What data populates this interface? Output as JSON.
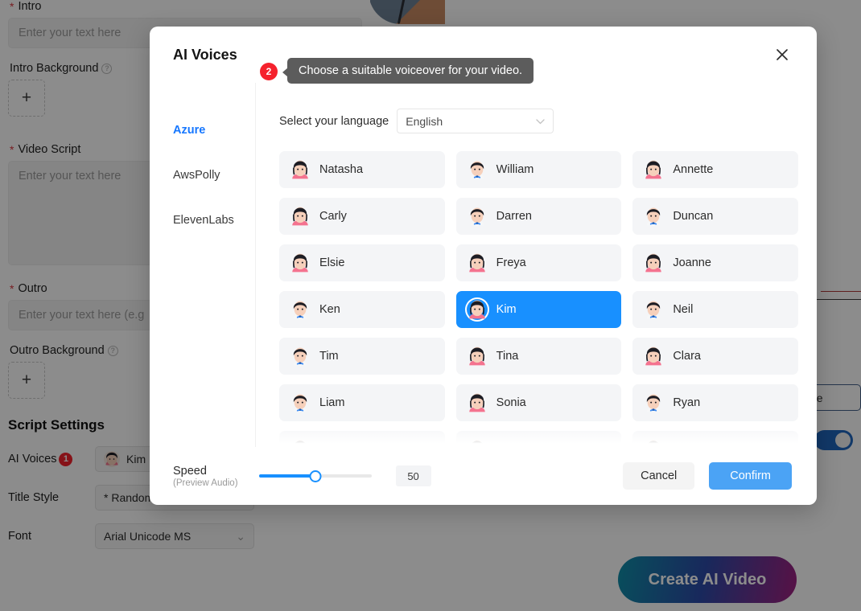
{
  "background": {
    "fields": [
      {
        "label": "Intro",
        "required": true,
        "placeholder": "Enter your text here",
        "type": "input"
      },
      {
        "label": "Intro Background",
        "required": false,
        "help": true,
        "type": "upload",
        "upload_glyph": "+"
      },
      {
        "label": "Video Script",
        "required": true,
        "placeholder": "Enter your text here",
        "type": "textarea"
      },
      {
        "label": "Outro",
        "required": true,
        "placeholder": "Enter your text here (e.g",
        "type": "input"
      },
      {
        "label": "Outro Background",
        "required": false,
        "help": true,
        "type": "upload",
        "upload_glyph": "+"
      }
    ],
    "section_title": "Script Settings",
    "settings": [
      {
        "label": "AI Voices",
        "badge": "1",
        "value": "Kim",
        "chev": "›",
        "has_avatar": true
      },
      {
        "label": "Title Style",
        "badge": "",
        "value": "* Random",
        "chev": "›",
        "has_avatar": false
      },
      {
        "label": "Font",
        "badge": "",
        "value": "Arial Unicode MS",
        "chev": "⌄",
        "has_avatar": false
      }
    ],
    "right_partial_button": "ne",
    "create_button": "Create AI Video",
    "create_gradient_from": "#0f8fa8",
    "create_gradient_to": "#a0207f"
  },
  "modal": {
    "title": "AI Voices",
    "close_glyph": "✕",
    "providers": [
      {
        "label": "Azure",
        "active": true
      },
      {
        "label": "AwsPolly",
        "active": false
      },
      {
        "label": "ElevenLabs",
        "active": false
      }
    ],
    "language": {
      "label": "Select your language",
      "selected": "English",
      "chevron": "⌄"
    },
    "tooltip": {
      "badge": "2",
      "text": "Choose a suitable voiceover for your video.",
      "bg": "#5c5c5c"
    },
    "selected_voice": "Kim",
    "accent_color": "#1890ff",
    "voices": [
      {
        "name": "Natasha",
        "gender": "female"
      },
      {
        "name": "William",
        "gender": "male"
      },
      {
        "name": "Annette",
        "gender": "female"
      },
      {
        "name": "Carly",
        "gender": "female"
      },
      {
        "name": "Darren",
        "gender": "male"
      },
      {
        "name": "Duncan",
        "gender": "male"
      },
      {
        "name": "Elsie",
        "gender": "female"
      },
      {
        "name": "Freya",
        "gender": "female"
      },
      {
        "name": "Joanne",
        "gender": "female"
      },
      {
        "name": "Ken",
        "gender": "male"
      },
      {
        "name": "Kim",
        "gender": "female"
      },
      {
        "name": "Neil",
        "gender": "male"
      },
      {
        "name": "Tim",
        "gender": "male"
      },
      {
        "name": "Tina",
        "gender": "female"
      },
      {
        "name": "Clara",
        "gender": "female"
      },
      {
        "name": "Liam",
        "gender": "male"
      },
      {
        "name": "Sonia",
        "gender": "female"
      },
      {
        "name": "Ryan",
        "gender": "male"
      },
      {
        "name": "",
        "gender": "female"
      },
      {
        "name": "",
        "gender": "female"
      },
      {
        "name": "",
        "gender": "female"
      }
    ],
    "footer": {
      "speed_label": "Speed",
      "speed_sub": "(Preview Audio)",
      "speed_value": "50",
      "speed_percent": 50,
      "cancel_label": "Cancel",
      "confirm_label": "Confirm"
    }
  }
}
